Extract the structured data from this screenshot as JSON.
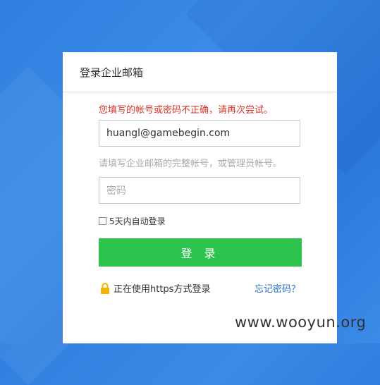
{
  "login": {
    "title": "登录企业邮箱",
    "error_message": "您填写的帐号或密码不正确，请再次尝试。",
    "email_value": "huangl@gamebegin.com",
    "email_hint": "请填写企业邮箱的完整帐号，或管理员帐号。",
    "password_placeholder": "密码",
    "remember_label": "5天内自动登录",
    "submit_label": "登 录",
    "https_label": "正在使用https方式登录",
    "forgot_label": "忘记密码？"
  },
  "watermark": {
    "text": "www.wooyun.org"
  },
  "icons": {
    "lock": "lock-icon"
  },
  "colors": {
    "error": "#d8352a",
    "button": "#2dc44e",
    "link": "#2a6fc9",
    "background": "#2f7fe0",
    "lock": "#f0b400"
  }
}
